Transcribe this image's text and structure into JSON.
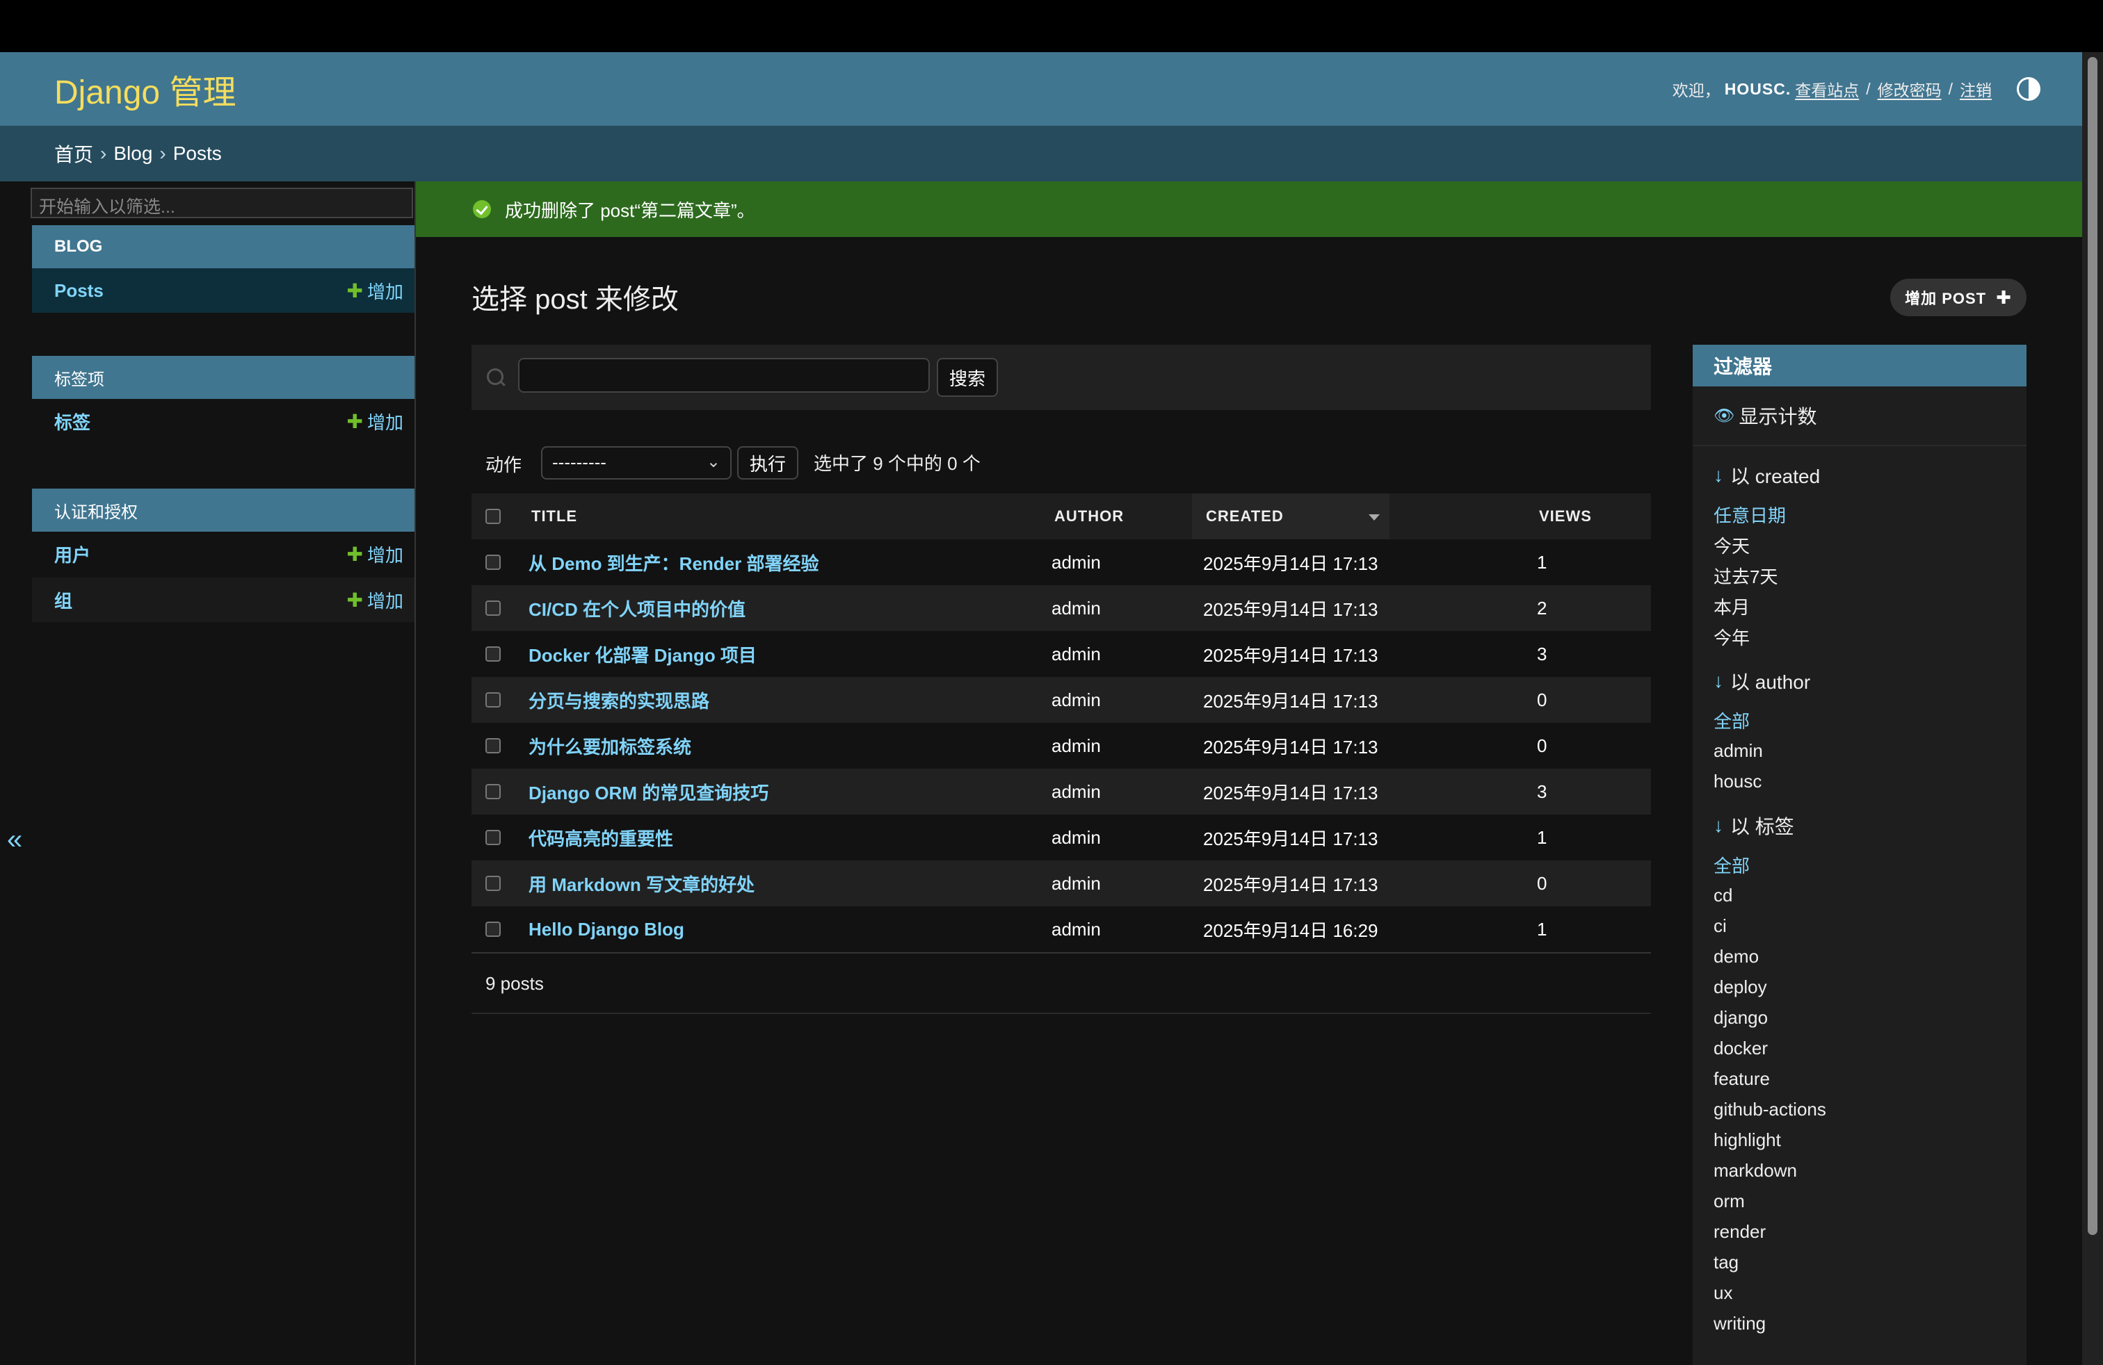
{
  "header": {
    "brand": "Django 管理",
    "welcome": "欢迎，",
    "username": "HOUSC.",
    "links": [
      "查看站点",
      "修改密码",
      "注销"
    ],
    "separator": "/"
  },
  "breadcrumbs": [
    "首页",
    "Blog",
    "Posts"
  ],
  "breadcrumb_sep": "›",
  "sidebar": {
    "filter_placeholder": "开始输入以筛选...",
    "modules": [
      {
        "caption": "BLOG",
        "rows": [
          {
            "label": "Posts",
            "add": "增加"
          }
        ]
      },
      {
        "caption": "标签项",
        "rows": [
          {
            "label": "标签",
            "add": "增加"
          }
        ]
      },
      {
        "caption": "认证和授权",
        "rows": [
          {
            "label": "用户",
            "add": "增加"
          },
          {
            "label": "组",
            "add": "增加"
          }
        ]
      }
    ],
    "collapse_label": "«"
  },
  "message": "成功删除了 post“第二篇文章”。",
  "page_title": "选择 post 来修改",
  "add_button": "增加 POST",
  "search": {
    "button": "搜索",
    "value": ""
  },
  "actions": {
    "label": "动作",
    "selected": "---------",
    "go": "执行",
    "counter": "选中了 9 个中的 0 个"
  },
  "table": {
    "headers": [
      "TITLE",
      "AUTHOR",
      "CREATED",
      "VIEWS"
    ],
    "rows": [
      {
        "title": "从 Demo 到生产：Render 部署经验",
        "author": "admin",
        "created": "2025年9月14日 17:13",
        "views": "1"
      },
      {
        "title": "CI/CD 在个人项目中的价值",
        "author": "admin",
        "created": "2025年9月14日 17:13",
        "views": "2"
      },
      {
        "title": "Docker 化部署 Django 项目",
        "author": "admin",
        "created": "2025年9月14日 17:13",
        "views": "3"
      },
      {
        "title": "分页与搜索的实现思路",
        "author": "admin",
        "created": "2025年9月14日 17:13",
        "views": "0"
      },
      {
        "title": "为什么要加标签系统",
        "author": "admin",
        "created": "2025年9月14日 17:13",
        "views": "0"
      },
      {
        "title": "Django ORM 的常见查询技巧",
        "author": "admin",
        "created": "2025年9月14日 17:13",
        "views": "3"
      },
      {
        "title": "代码高亮的重要性",
        "author": "admin",
        "created": "2025年9月14日 17:13",
        "views": "1"
      },
      {
        "title": "用 Markdown 写文章的好处",
        "author": "admin",
        "created": "2025年9月14日 17:13",
        "views": "0"
      },
      {
        "title": "Hello Django Blog",
        "author": "admin",
        "created": "2025年9月14日 16:29",
        "views": "1"
      }
    ]
  },
  "paginator": "9 posts",
  "filter": {
    "title": "过滤器",
    "show_counts": "显示计数",
    "groups": [
      {
        "heading": "以 created",
        "items": [
          "任意日期",
          "今天",
          "过去7天",
          "本月",
          "今年"
        ],
        "selected": 0
      },
      {
        "heading": "以 author",
        "items": [
          "全部",
          "admin",
          "housc"
        ],
        "selected": 0
      },
      {
        "heading": "以 标签",
        "items": [
          "全部",
          "cd",
          "ci",
          "demo",
          "deploy",
          "django",
          "docker",
          "feature",
          "github-actions",
          "highlight",
          "markdown",
          "orm",
          "render",
          "tag",
          "ux",
          "writing"
        ],
        "selected": 0
      }
    ]
  },
  "colors": {
    "header": "#417690",
    "breadcrumbs": "#264b5d",
    "success": "#2d6a1e",
    "link": "#81d4fa",
    "brand": "#f5dd5d",
    "add_icon": "#70bf2b"
  }
}
